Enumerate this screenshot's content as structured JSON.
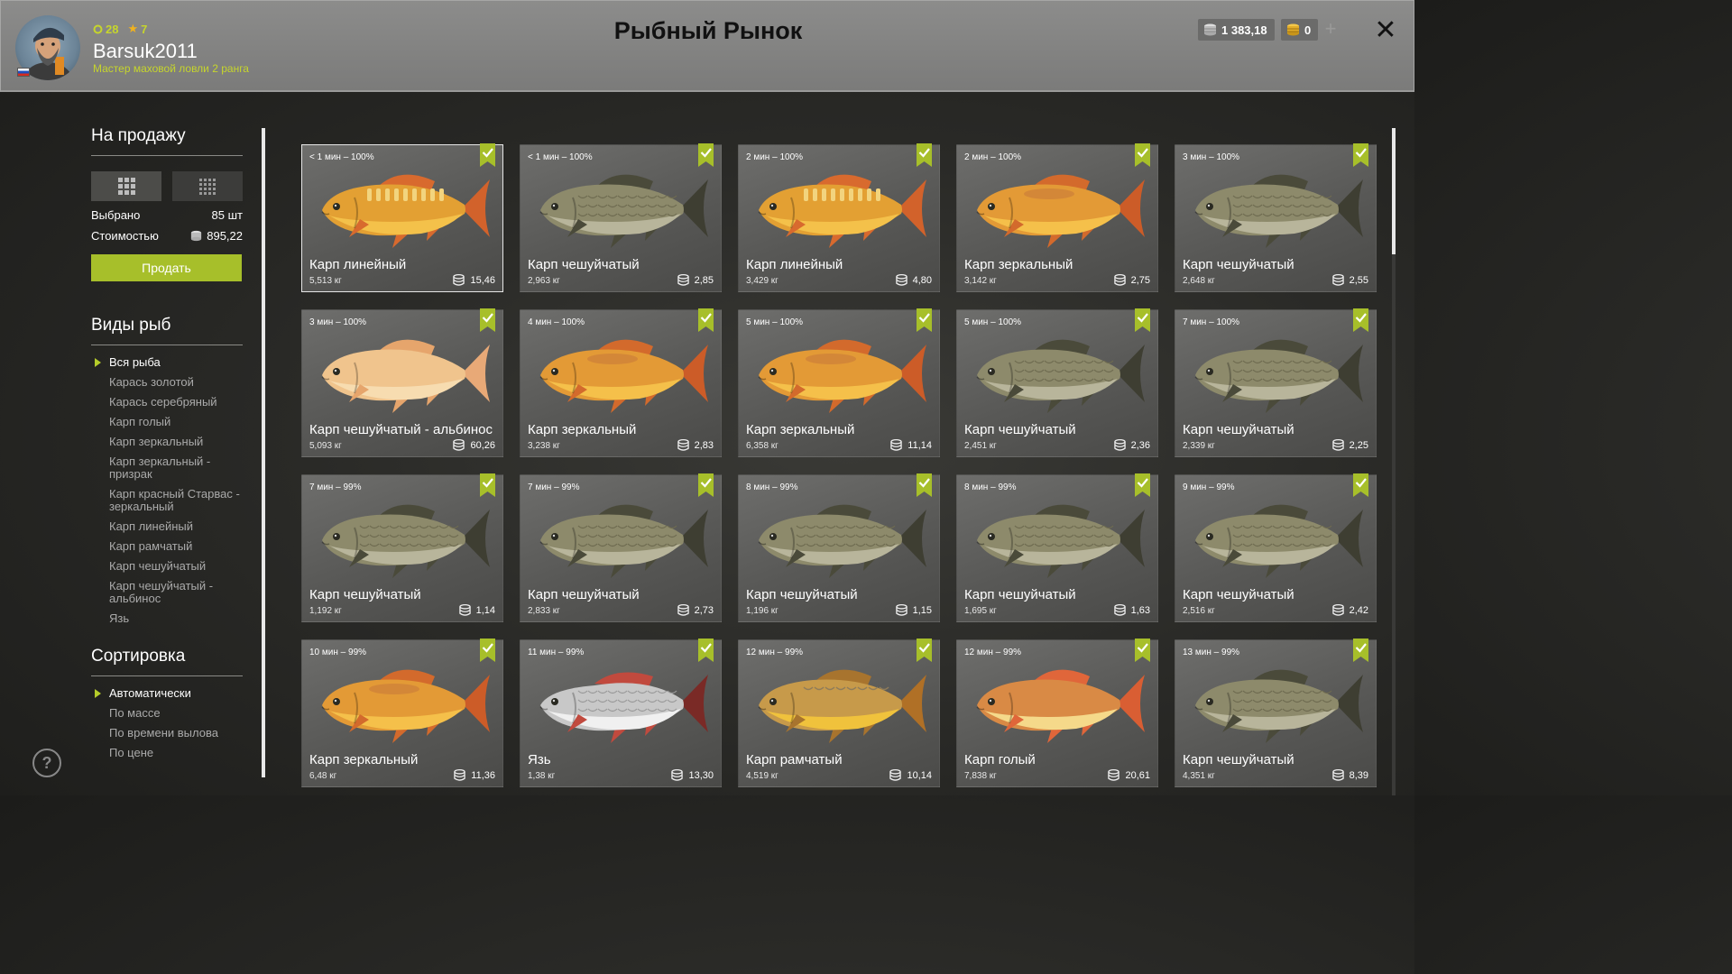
{
  "header": {
    "level": "28",
    "stars": "7",
    "username": "Barsuk2011",
    "rank": "Мастер маховой ловли 2 ранга",
    "title": "Рыбный Рынок",
    "silver": "1 383,18",
    "gold": "0",
    "plus": "+",
    "close": "✕"
  },
  "sidebar": {
    "for_sale_heading": "На продажу",
    "selected_label": "Выбрано",
    "selected_value": "85 шт",
    "cost_label": "Стоимостью",
    "cost_value": "895,22",
    "sell_button": "Продать",
    "species_heading": "Виды рыб",
    "species": [
      {
        "label": "Вся рыба",
        "active": true
      },
      {
        "label": "Карась золотой",
        "active": false
      },
      {
        "label": "Карась серебряный",
        "active": false
      },
      {
        "label": "Карп голый",
        "active": false
      },
      {
        "label": "Карп зеркальный",
        "active": false
      },
      {
        "label": "Карп зеркальный - призрак",
        "active": false
      },
      {
        "label": "Карп красный Старвас - зеркальный",
        "active": false
      },
      {
        "label": "Карп линейный",
        "active": false
      },
      {
        "label": "Карп рамчатый",
        "active": false
      },
      {
        "label": "Карп чешуйчатый",
        "active": false
      },
      {
        "label": "Карп чешуйчатый - альбинос",
        "active": false
      },
      {
        "label": "Язь",
        "active": false
      }
    ],
    "sort_heading": "Сортировка",
    "sort": [
      {
        "label": "Автоматически",
        "active": true
      },
      {
        "label": "По массе",
        "active": false
      },
      {
        "label": "По времени вылова",
        "active": false
      },
      {
        "label": "По цене",
        "active": false
      }
    ],
    "help": "?"
  },
  "colors": {
    "accent": "#a7bf2a",
    "check": "#a7bf2a"
  },
  "cards": [
    {
      "time": "< 1 мин – 100%",
      "name": "Карп линейный",
      "weight": "5,513 кг",
      "price": "15,46",
      "kind": "linear",
      "selected": true
    },
    {
      "time": "< 1 мин – 100%",
      "name": "Карп чешуйчатый",
      "weight": "2,963 кг",
      "price": "2,85",
      "kind": "scaled"
    },
    {
      "time": "2 мин – 100%",
      "name": "Карп линейный",
      "weight": "3,429 кг",
      "price": "4,80",
      "kind": "linear"
    },
    {
      "time": "2 мин – 100%",
      "name": "Карп зеркальный",
      "weight": "3,142 кг",
      "price": "2,75",
      "kind": "mirror"
    },
    {
      "time": "3 мин – 100%",
      "name": "Карп чешуйчатый",
      "weight": "2,648 кг",
      "price": "2,55",
      "kind": "scaled"
    },
    {
      "time": "3 мин – 100%",
      "name": "Карп чешуйчатый - альбинос",
      "weight": "5,093 кг",
      "price": "60,26",
      "kind": "albino"
    },
    {
      "time": "4 мин – 100%",
      "name": "Карп зеркальный",
      "weight": "3,238 кг",
      "price": "2,83",
      "kind": "mirror"
    },
    {
      "time": "5 мин – 100%",
      "name": "Карп зеркальный",
      "weight": "6,358 кг",
      "price": "11,14",
      "kind": "mirror"
    },
    {
      "time": "5 мин – 100%",
      "name": "Карп чешуйчатый",
      "weight": "2,451 кг",
      "price": "2,36",
      "kind": "scaled"
    },
    {
      "time": "7 мин – 100%",
      "name": "Карп чешуйчатый",
      "weight": "2,339 кг",
      "price": "2,25",
      "kind": "scaled"
    },
    {
      "time": "7 мин – 99%",
      "name": "Карп чешуйчатый",
      "weight": "1,192 кг",
      "price": "1,14",
      "kind": "scaled"
    },
    {
      "time": "7 мин – 99%",
      "name": "Карп чешуйчатый",
      "weight": "2,833 кг",
      "price": "2,73",
      "kind": "scaled"
    },
    {
      "time": "8 мин – 99%",
      "name": "Карп чешуйчатый",
      "weight": "1,196 кг",
      "price": "1,15",
      "kind": "scaled"
    },
    {
      "time": "8 мин – 99%",
      "name": "Карп чешуйчатый",
      "weight": "1,695 кг",
      "price": "1,63",
      "kind": "scaled"
    },
    {
      "time": "9 мин – 99%",
      "name": "Карп чешуйчатый",
      "weight": "2,516 кг",
      "price": "2,42",
      "kind": "scaled"
    },
    {
      "time": "10 мин – 99%",
      "name": "Карп зеркальный",
      "weight": "6,48 кг",
      "price": "11,36",
      "kind": "mirror"
    },
    {
      "time": "11 мин – 99%",
      "name": "Язь",
      "weight": "1,38 кг",
      "price": "13,30",
      "kind": "ide"
    },
    {
      "time": "12 мин – 99%",
      "name": "Карп рамчатый",
      "weight": "4,519 кг",
      "price": "10,14",
      "kind": "frame"
    },
    {
      "time": "12 мин – 99%",
      "name": "Карп голый",
      "weight": "7,838 кг",
      "price": "20,61",
      "kind": "naked"
    },
    {
      "time": "13 мин – 99%",
      "name": "Карп чешуйчатый",
      "weight": "4,351 кг",
      "price": "8,39",
      "kind": "scaled"
    }
  ]
}
